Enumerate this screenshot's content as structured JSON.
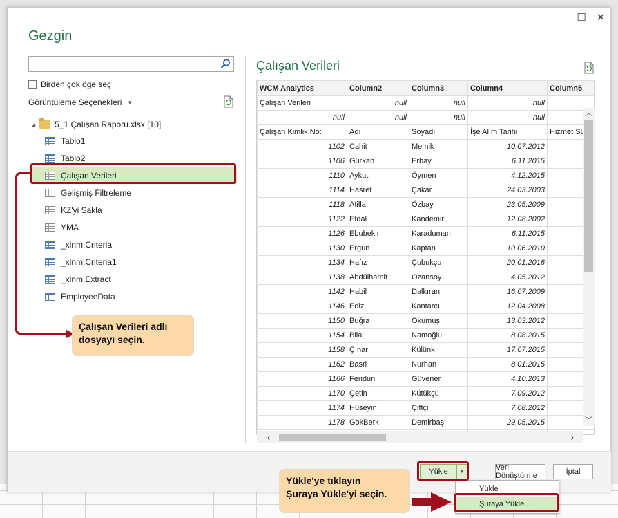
{
  "dialog": {
    "title": "Gezgin",
    "maximize_glyph": "☐",
    "close_glyph": "✕"
  },
  "left": {
    "search_placeholder": "",
    "multi_select_label": "Birden çok öğe seç",
    "view_options_label": "Görüntüleme Seçenekleri",
    "root": {
      "label": "5_1 Çalışan Raporu.xlsx [10]"
    },
    "items": [
      {
        "label": "Tablo1",
        "icon": "table-icon"
      },
      {
        "label": "Tablo2",
        "icon": "table-icon"
      },
      {
        "label": "Çalışan Verileri",
        "icon": "sheet-icon",
        "selected": true
      },
      {
        "label": "Gelişmiş Filtreleme",
        "icon": "sheet-icon"
      },
      {
        "label": "KZ'yi Sakla",
        "icon": "sheet-icon"
      },
      {
        "label": "YMA",
        "icon": "sheet-icon"
      },
      {
        "label": "_xlnm.Criteria",
        "icon": "table-icon"
      },
      {
        "label": "_xlnm.Criteria1",
        "icon": "table-icon"
      },
      {
        "label": "_xlnm.Extract",
        "icon": "table-icon"
      },
      {
        "label": "EmployeeData",
        "icon": "table-icon"
      }
    ]
  },
  "preview": {
    "title": "Çalışan Verileri",
    "columns": [
      "WCM Analytics",
      "Column2",
      "Column3",
      "Column4",
      "Column5"
    ],
    "header_rows": [
      [
        "Çalışan Verileri",
        "null",
        "null",
        "null",
        ""
      ],
      [
        "null",
        "null",
        "null",
        "null",
        ""
      ],
      [
        "Çalışan Kimlik No:",
        "Adı",
        "Soyadı",
        "İşe Alım Tarihi",
        "Hizmet Sü"
      ]
    ],
    "rows": [
      [
        "1102",
        "Cahit",
        "Memik",
        "10.07.2012"
      ],
      [
        "1106",
        "Gürkan",
        "Erbay",
        "6.11.2015"
      ],
      [
        "1110",
        "Aykut",
        "Öymen",
        "4.12.2015"
      ],
      [
        "1114",
        "Hasret",
        "Çakar",
        "24.03.2003"
      ],
      [
        "1118",
        "Atilla",
        "Özbay",
        "23.05.2009"
      ],
      [
        "1122",
        "Efdal",
        "Kandemir",
        "12.08.2002"
      ],
      [
        "1126",
        "Ebubekir",
        "Karaduman",
        "6.11.2015"
      ],
      [
        "1130",
        "Ergun",
        "Kaptan",
        "10.06.2010"
      ],
      [
        "1134",
        "Hafız",
        "Çubukçu",
        "20.01.2016"
      ],
      [
        "1138",
        "Abdülhamit",
        "Ozansoy",
        "4.05.2012"
      ],
      [
        "1142",
        "Habil",
        "Dalkıran",
        "16.07.2009"
      ],
      [
        "1146",
        "Ediz",
        "Kantarcı",
        "12.04.2008"
      ],
      [
        "1150",
        "Buğra",
        "Okumuş",
        "13.03.2012"
      ],
      [
        "1154",
        "Bilal",
        "Namoğlu",
        "8.08.2015"
      ],
      [
        "1158",
        "Çınar",
        "Külünk",
        "17.07.2015"
      ],
      [
        "1162",
        "Basri",
        "Nurhan",
        "8.01.2015"
      ],
      [
        "1166",
        "Feridun",
        "Güvener",
        "4.10.2013"
      ],
      [
        "1170",
        "Çetin",
        "Kütükçü",
        "7.09.2012"
      ],
      [
        "1174",
        "Hüseyin",
        "Çiftçi",
        "7.08.2012"
      ],
      [
        "1178",
        "GökBerk",
        "Demirbaş",
        "29.05.2015"
      ],
      [
        "",
        "",
        "",
        ""
      ]
    ]
  },
  "footer": {
    "load_label": "Yükle",
    "transform_label": "Veri Dönüştürme",
    "cancel_label": "İptal",
    "menu": {
      "load_label": "Yükle",
      "load_to_label": "Şuraya Yükle..."
    }
  },
  "callouts": {
    "select_file_line1": "Çalışan Verileri adlı",
    "select_file_line2": "dosyayı seçin.",
    "load_line1": "Yükle'ye tıklayın",
    "load_line2": "Şuraya Yükle'yi seçin."
  },
  "colors": {
    "accent_green": "#217346",
    "selection": "#d9eac2",
    "callout_bg": "#fcd9a8",
    "highlight_red": "#a00e1c"
  }
}
